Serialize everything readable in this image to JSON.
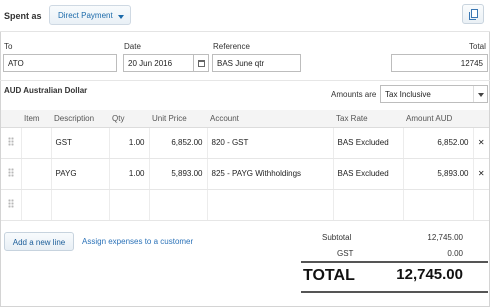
{
  "header": {
    "spent_as_label": "Spent as",
    "type_button": "Direct Payment",
    "copy_icon": "copy-icon"
  },
  "form": {
    "to_label": "To",
    "to_value": "ATO",
    "date_label": "Date",
    "date_value": "20 Jun 2016",
    "reference_label": "Reference",
    "reference_value": "BAS June qtr",
    "total_label": "Total",
    "total_value": "12745"
  },
  "options": {
    "currency": "AUD Australian Dollar",
    "amounts_are_label": "Amounts are",
    "amounts_are_value": "Tax Inclusive"
  },
  "table": {
    "columns": [
      "Item",
      "Description",
      "Qty",
      "Unit Price",
      "Account",
      "Tax Rate",
      "Amount AUD"
    ],
    "rows": [
      {
        "item": "",
        "description": "GST",
        "qty": "1.00",
        "unit_price": "6,852.00",
        "account": "820 - GST",
        "tax_rate": "BAS Excluded",
        "amount": "6,852.00"
      },
      {
        "item": "",
        "description": "PAYG",
        "qty": "1.00",
        "unit_price": "5,893.00",
        "account": "825 - PAYG Withholdings",
        "tax_rate": "BAS Excluded",
        "amount": "5,893.00"
      },
      {
        "item": "",
        "description": "",
        "qty": "",
        "unit_price": "",
        "account": "",
        "tax_rate": "",
        "amount": ""
      }
    ]
  },
  "actions": {
    "add_line": "Add a new line",
    "assign_link": "Assign expenses to a customer"
  },
  "totals": {
    "subtotal_label": "Subtotal",
    "subtotal_value": "12,745.00",
    "gst_label": "GST",
    "gst_value": "0.00",
    "total_label": "TOTAL",
    "total_value": "12,745.00"
  }
}
